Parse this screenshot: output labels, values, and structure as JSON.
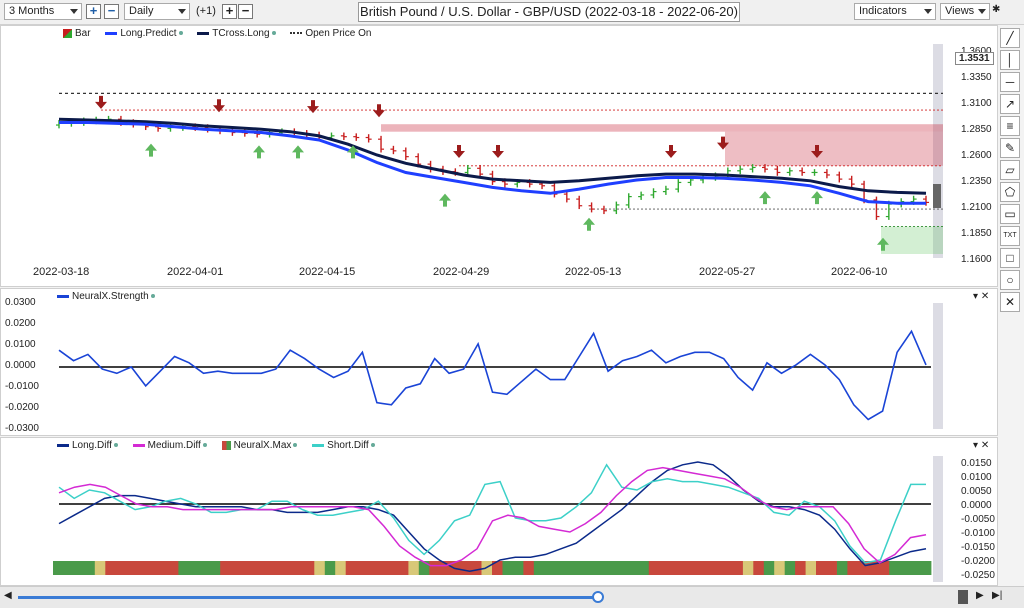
{
  "toolbar": {
    "range_value": "3 Months",
    "interval_value": "Daily",
    "plus_label": "+",
    "minus_label": "−",
    "offset_label": "(+1)",
    "indicators_label": "Indicators",
    "views_label": "Views"
  },
  "title": "British Pound / U.S. Dollar - GBP/USD (2022-03-18 - 2022-06-20)",
  "price_panel": {
    "legend": [
      {
        "name": "Bar",
        "color": "#2e8b2e"
      },
      {
        "name": "Long.Predict",
        "color": "#1f3fff"
      },
      {
        "name": "TCross.Long",
        "color": "#0b1a4a"
      },
      {
        "name": "Open Price On",
        "color": "#333333"
      }
    ],
    "price_badge": "1.3531",
    "y_ticks": [
      "1.3600",
      "1.3350",
      "1.3100",
      "1.2850",
      "1.2600",
      "1.2350",
      "1.2100",
      "1.1850",
      "1.1600"
    ],
    "x_labels": [
      "2022-03-18",
      "2022-04-01",
      "2022-04-15",
      "2022-04-29",
      "2022-05-13",
      "2022-05-27",
      "2022-06-10"
    ]
  },
  "strength_panel": {
    "legend": "NeuralX.Strength",
    "y_ticks": [
      "0.0300",
      "0.0200",
      "0.0100",
      "0.0000",
      "-0.0100",
      "-0.0200",
      "-0.0300"
    ]
  },
  "diff_panel": {
    "legend": [
      {
        "name": "Long.Diff",
        "color": "#0b2a8a"
      },
      {
        "name": "Medium.Diff",
        "color": "#d42ad4"
      },
      {
        "name": "NeuralX.Max",
        "color": "#c83232"
      },
      {
        "name": "Short.Diff",
        "color": "#3cd0c8"
      }
    ],
    "y_ticks": [
      "0.0150",
      "0.0100",
      "0.0050",
      "0.0000",
      "-0.0050",
      "-0.0100",
      "-0.0150",
      "-0.0200",
      "-0.0250"
    ]
  },
  "chart_data": [
    {
      "type": "line",
      "title": "British Pound / U.S. Dollar - GBP/USD (2022-03-18 - 2022-06-20)",
      "x_range": [
        "2022-03-18",
        "2022-06-20"
      ],
      "ylim": [
        1.16,
        1.36
      ],
      "colors": {
        "up": "#2fa82f",
        "down": "#c81e1e",
        "long_predict": "#1f3fff",
        "tcross_long": "#0b1a4a"
      },
      "series": [
        {
          "name": "Bar",
          "close": [
            1.317,
            1.318,
            1.32,
            1.321,
            1.322,
            1.318,
            1.316,
            1.313,
            1.311,
            1.312,
            1.313,
            1.312,
            1.31,
            1.308,
            1.306,
            1.305,
            1.304,
            1.306,
            1.307,
            1.305,
            1.303,
            1.3,
            1.302,
            1.301,
            1.3,
            1.298,
            1.286,
            1.284,
            1.277,
            1.268,
            1.262,
            1.259,
            1.258,
            1.263,
            1.256,
            1.247,
            1.244,
            1.246,
            1.244,
            1.242,
            1.232,
            1.226,
            1.218,
            1.214,
            1.212,
            1.219,
            1.229,
            1.231,
            1.235,
            1.238,
            1.246,
            1.249,
            1.252,
            1.254,
            1.26,
            1.262,
            1.264,
            1.262,
            1.258,
            1.26,
            1.258,
            1.258,
            1.255,
            1.25,
            1.244,
            1.225,
            1.205,
            1.22,
            1.223,
            1.226,
            1.222
          ]
        },
        {
          "name": "Long.Predict",
          "values": [
            1.318,
            1.318,
            1.317,
            1.316,
            1.313,
            1.31,
            1.308,
            1.306,
            1.302,
            1.297,
            1.285,
            1.27,
            1.258,
            1.252,
            1.246,
            1.24,
            1.236,
            1.233,
            1.238,
            1.244,
            1.249,
            1.252,
            1.252,
            1.251,
            1.249,
            1.246,
            1.242,
            1.233,
            1.223,
            1.221,
            1.221
          ]
        },
        {
          "name": "TCross.Long",
          "values": [
            1.322,
            1.321,
            1.32,
            1.319,
            1.317,
            1.314,
            1.312,
            1.31,
            1.307,
            1.302,
            1.292,
            1.279,
            1.269,
            1.262,
            1.255,
            1.25,
            1.248,
            1.246,
            1.248,
            1.251,
            1.254,
            1.256,
            1.256,
            1.255,
            1.253,
            1.251,
            1.248,
            1.241,
            1.236,
            1.234,
            1.233
          ]
        },
        {
          "name": "Open Price On",
          "values": [
            1.3531
          ]
        }
      ]
    },
    {
      "type": "line",
      "ylim": [
        -0.03,
        0.03
      ],
      "series": [
        {
          "name": "NeuralX.Strength",
          "color": "#1a44d6",
          "values": [
            0.008,
            0.003,
            0.006,
            -0.001,
            -0.003,
            0.0,
            -0.009,
            -0.002,
            0.005,
            0.002,
            -0.003,
            -0.002,
            -0.003,
            -0.003,
            -0.003,
            -0.001,
            0.008,
            0.004,
            -0.001,
            -0.005,
            -0.002,
            0.007,
            -0.017,
            -0.018,
            -0.01,
            -0.008,
            0.004,
            -0.003,
            -0.001,
            0.011,
            -0.012,
            -0.013,
            -0.007,
            -0.001,
            -0.006,
            -0.006,
            0.005,
            0.016,
            -0.002,
            0.003,
            0.005,
            0.008,
            0.002,
            0.005,
            0.007,
            0.007,
            0.004,
            -0.005,
            -0.011,
            0.002,
            -0.003,
            0.001,
            0.006,
            0.001,
            -0.006,
            -0.018,
            -0.025,
            -0.021,
            0.007,
            0.017,
            0.001
          ]
        }
      ]
    },
    {
      "type": "line",
      "ylim": [
        -0.025,
        0.0175
      ],
      "series": [
        {
          "name": "Long.Diff",
          "color": "#0b2a8a",
          "values": [
            -0.007,
            -0.004,
            -0.001,
            0.002,
            0.003,
            0.003,
            0.002,
            0.001,
            0.0,
            -0.001,
            -0.001,
            -0.001,
            -0.001,
            -0.002,
            -0.002,
            -0.003,
            -0.003,
            -0.003,
            -0.002,
            -0.001,
            -0.001,
            -0.002,
            -0.004,
            -0.01,
            -0.016,
            -0.02,
            -0.023,
            -0.024,
            -0.023,
            -0.02,
            -0.019,
            -0.019,
            -0.018,
            -0.016,
            -0.014,
            -0.01,
            -0.006,
            -0.002,
            0.003,
            0.008,
            0.012,
            0.014,
            0.015,
            0.014,
            0.01,
            0.005,
            0.001,
            -0.001,
            -0.001,
            -0.002,
            -0.004,
            -0.009,
            -0.016,
            -0.022,
            -0.021,
            -0.019,
            -0.017,
            -0.016
          ]
        },
        {
          "name": "Medium.Diff",
          "color": "#d42ad4",
          "values": [
            0.004,
            0.006,
            0.007,
            0.006,
            0.003,
            0.0,
            -0.001,
            -0.001,
            -0.002,
            -0.002,
            -0.002,
            -0.002,
            -0.002,
            -0.002,
            -0.002,
            -0.001,
            -0.001,
            -0.001,
            -0.001,
            -0.001,
            -0.002,
            -0.008,
            -0.015,
            -0.019,
            -0.022,
            -0.022,
            -0.02,
            -0.016,
            -0.006,
            -0.004,
            -0.005,
            -0.008,
            -0.009,
            -0.01,
            -0.007,
            -0.003,
            0.003,
            0.008,
            0.012,
            0.013,
            0.012,
            0.011,
            0.01,
            0.009,
            0.006,
            0.002,
            -0.001,
            -0.002,
            -0.001,
            -0.001,
            -0.001,
            -0.007,
            -0.016,
            -0.021,
            -0.018,
            -0.012,
            -0.011
          ]
        },
        {
          "name": "Short.Diff",
          "color": "#3cd0c8",
          "values": [
            0.006,
            0.002,
            0.005,
            0.004,
            0.001,
            -0.002,
            -0.001,
            0.001,
            0.002,
            0.0,
            -0.003,
            -0.003,
            -0.002,
            -0.002,
            0.001,
            0.001,
            -0.002,
            -0.004,
            -0.004,
            -0.003,
            -0.002,
            0.001,
            -0.005,
            -0.013,
            -0.018,
            -0.013,
            -0.006,
            -0.004,
            0.007,
            0.008,
            -0.005,
            -0.006,
            -0.006,
            -0.005,
            -0.001,
            0.004,
            0.014,
            0.006,
            0.005,
            0.008,
            0.009,
            0.008,
            0.008,
            0.007,
            0.006,
            0.004,
            0.002,
            -0.003,
            -0.004,
            0.001,
            -0.001,
            -0.006,
            -0.015,
            -0.021,
            -0.02,
            -0.006,
            0.007,
            0.007
          ]
        },
        {
          "name": "NeuralX.Max",
          "type": "bar",
          "colors": {
            "up": "#4a9a4a",
            "down": "#c8483c",
            "neutral": "#d8c878"
          },
          "states": [
            "u",
            "u",
            "u",
            "u",
            "n",
            "d",
            "d",
            "d",
            "d",
            "d",
            "d",
            "d",
            "u",
            "u",
            "u",
            "u",
            "d",
            "d",
            "d",
            "d",
            "d",
            "d",
            "d",
            "d",
            "d",
            "n",
            "u",
            "n",
            "d",
            "d",
            "d",
            "d",
            "d",
            "d",
            "n",
            "u",
            "d",
            "d",
            "d",
            "d",
            "d",
            "n",
            "d",
            "u",
            "u",
            "d",
            "u",
            "u",
            "u",
            "u",
            "u",
            "u",
            "u",
            "u",
            "u",
            "u",
            "u",
            "d",
            "d",
            "d",
            "d",
            "d",
            "d",
            "d",
            "d",
            "d",
            "n",
            "d",
            "u",
            "n",
            "u",
            "d",
            "n",
            "d",
            "d",
            "u",
            "d",
            "d",
            "d",
            "d",
            "u",
            "u",
            "u",
            "u"
          ]
        }
      ]
    }
  ]
}
